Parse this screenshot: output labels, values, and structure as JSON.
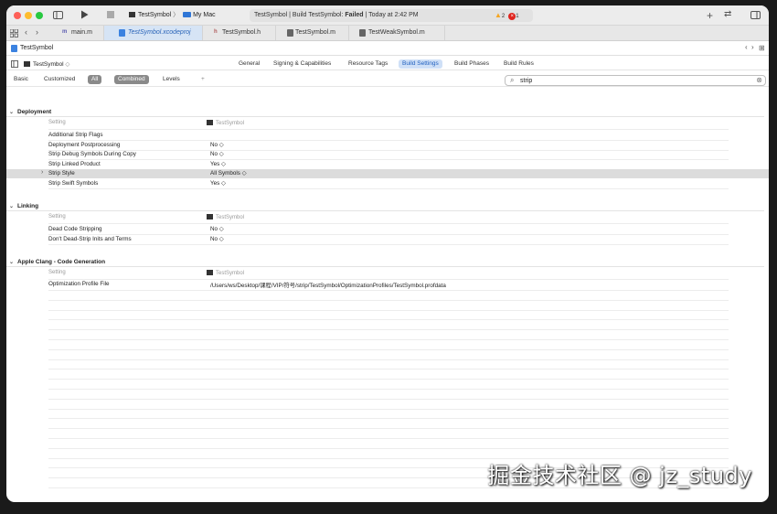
{
  "titlebar": {
    "scheme": "TestSymbol",
    "separator": "〉",
    "destination": "My Mac",
    "status_prefix": "TestSymbol | Build TestSymbol: ",
    "status_result": "Failed",
    "status_time": " | Today at 2:42 PM",
    "warning_count": "2",
    "error_count": "1",
    "colors": {
      "close": "#fe5f57",
      "minimize": "#febc2e",
      "zoom": "#28c840",
      "warning": "#f5a623",
      "error": "#e0241e"
    }
  },
  "file_tabs": [
    {
      "icon": "m",
      "label": "main.m",
      "active": false
    },
    {
      "icon": "proj",
      "label": "TestSymbol.xcodeproj",
      "active": true
    },
    {
      "icon": "h",
      "label": "TestSymbol.h",
      "active": false
    },
    {
      "icon": "m",
      "label": "TestSymbol.m",
      "active": false
    },
    {
      "icon": "m",
      "label": "TestWeakSymbol.m",
      "active": false
    }
  ],
  "jumpbar": {
    "project": "TestSymbol"
  },
  "editor_tabs": {
    "target": "TestSymbol",
    "target_suffix": "◇",
    "items": [
      "General",
      "Signing & Capabilities",
      "Resource Tags",
      "Build Settings",
      "Build Phases",
      "Build Rules"
    ],
    "selected": "Build Settings"
  },
  "filter": {
    "basic": "Basic",
    "customized": "Customized",
    "all": "All",
    "combined": "Combined",
    "levels": "Levels",
    "plus": "+",
    "search_value": "strip",
    "clear": "⊗"
  },
  "sections": {
    "deployment": {
      "title": "Deployment",
      "header_setting": "Setting",
      "header_target": "TestSymbol",
      "rows": [
        {
          "name": "Additional Strip Flags",
          "value": ""
        },
        {
          "name": "Deployment Postprocessing",
          "value": "No ◇"
        },
        {
          "name": "Strip Debug Symbols During Copy",
          "value": "No ◇"
        },
        {
          "name": "Strip Linked Product",
          "value": "Yes ◇"
        },
        {
          "name": "Strip Style",
          "value": "All Symbols ◇"
        },
        {
          "name": "Strip Swift Symbols",
          "value": "Yes ◇"
        }
      ]
    },
    "linking": {
      "title": "Linking",
      "header_setting": "Setting",
      "header_target": "TestSymbol",
      "rows": [
        {
          "name": "Dead Code Stripping",
          "value": "No ◇"
        },
        {
          "name": "Don't Dead-Strip Inits and Terms",
          "value": "No ◇"
        }
      ]
    },
    "clang": {
      "title": "Apple Clang - Code Generation",
      "header_setting": "Setting",
      "header_target": "TestSymbol",
      "rows": [
        {
          "name": "Optimization Profile File",
          "value": "/Users/ws/Desktop/课程/VIP/符号/strip/TestSymbol/OptimizationProfiles/TestSymbol.profdata"
        }
      ]
    }
  },
  "watermark": "掘金技术社区 @ jz_study"
}
